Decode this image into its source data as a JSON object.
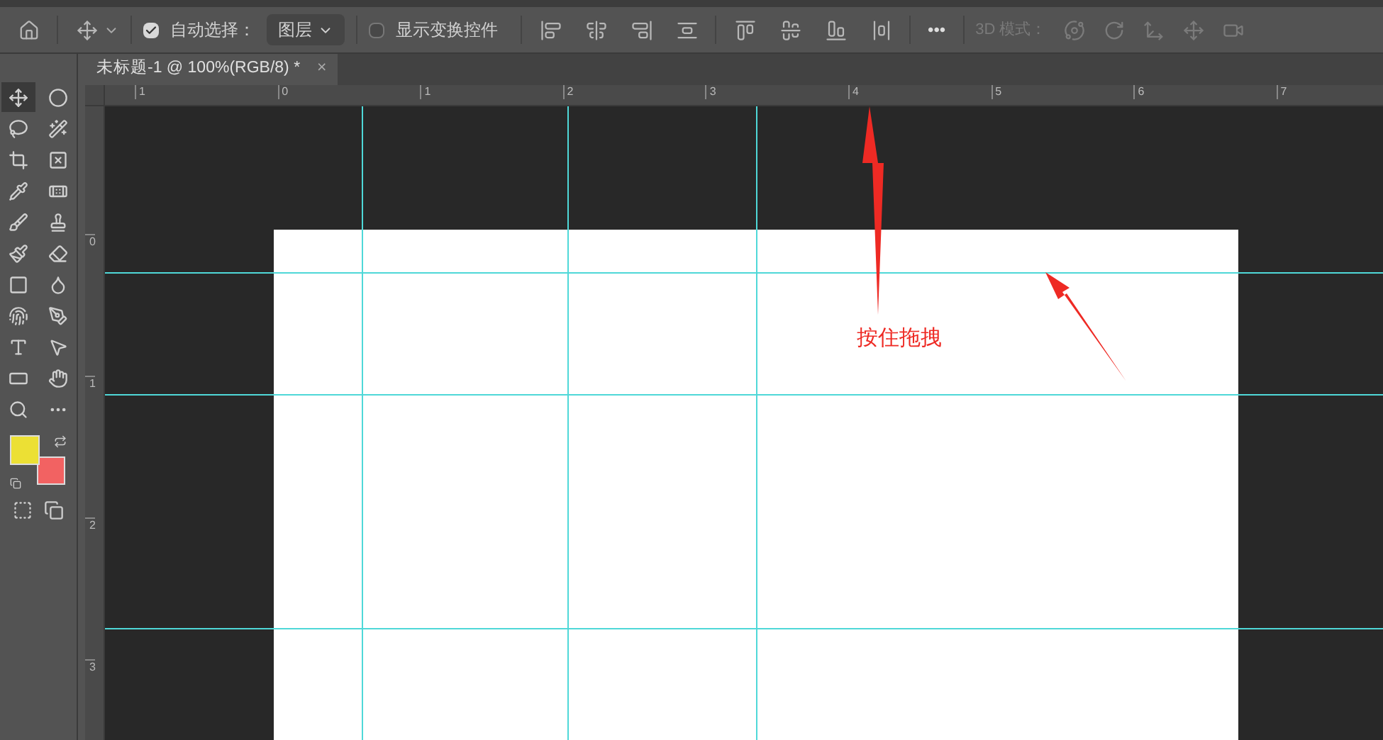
{
  "options_bar": {
    "auto_select": {
      "label": "自动选择：",
      "checked": true
    },
    "layer_dropdown": {
      "value": "图层"
    },
    "transform_controls": {
      "label": "显示变换控件",
      "checked": false
    },
    "more": "•••",
    "mode_3d": {
      "label": "3D 模式：",
      "disabled": true
    }
  },
  "document_tab": {
    "title": "未标题-1 @ 100%(RGB/8) *",
    "close": "×",
    "selected": true
  },
  "tools": [
    {
      "selected": true
    },
    {
      "selected": false
    },
    {
      "selected": false
    },
    {
      "selected": false
    },
    {
      "selected": false
    },
    {
      "selected": false
    },
    {
      "selected": false
    },
    {
      "selected": false
    },
    {
      "selected": false
    },
    {
      "selected": false
    },
    {
      "selected": false
    },
    {
      "selected": false
    },
    {
      "selected": false
    },
    {
      "selected": false
    },
    {
      "selected": false
    },
    {
      "selected": false
    },
    {
      "selected": false
    },
    {
      "selected": false
    },
    {
      "selected": false
    },
    {
      "selected": false
    },
    {
      "selected": false
    },
    {
      "selected": false
    }
  ],
  "swatches": {
    "foreground": {
      "color": "#ece034"
    },
    "background": {
      "color": "#f26262"
    }
  },
  "horizontal_ruler": {
    "labels": [
      "1",
      "0",
      "1",
      "2",
      "3",
      "4",
      "5",
      "6",
      "7"
    ]
  },
  "vertical_ruler": {
    "labels": [
      "0",
      "1",
      "2",
      "3"
    ]
  },
  "annotation": {
    "text": "按住拖拽"
  }
}
